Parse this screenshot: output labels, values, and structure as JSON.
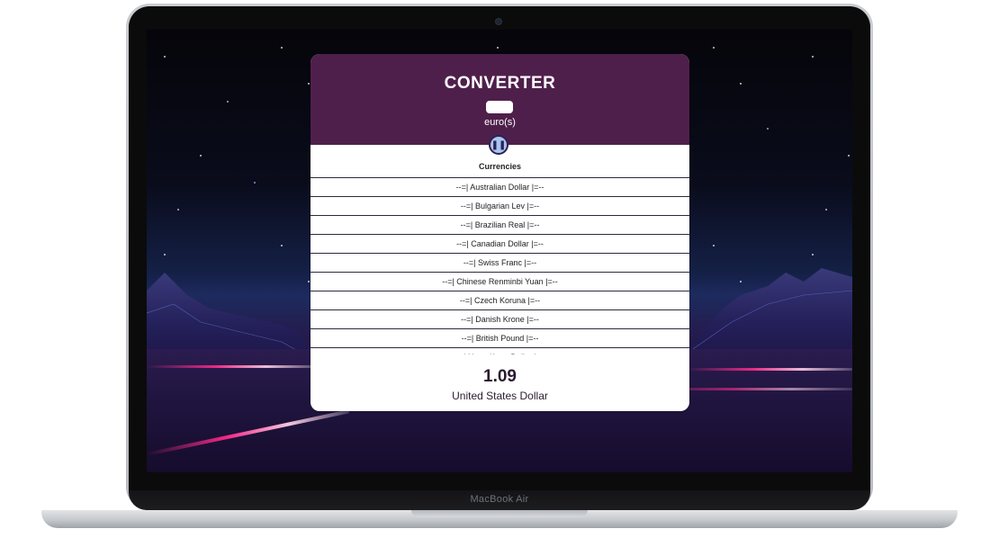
{
  "device": {
    "brand_label": "MacBook Air"
  },
  "converter": {
    "title": "CONVERTER",
    "amount_value": "",
    "unit_label": "euro(s)",
    "swap_icon": "pause-icon",
    "list_header": "Currencies",
    "currencies": [
      "--=| Australian Dollar |=--",
      "--=| Bulgarian Lev |=--",
      "--=| Brazilian Real |=--",
      "--=| Canadian Dollar |=--",
      "--=| Swiss Franc |=--",
      "--=| Chinese Renminbi Yuan |=--",
      "--=| Czech Koruna |=--",
      "--=| Danish Krone |=--",
      "--=| British Pound |=--",
      "--=| Hong Kong Dollar |=--"
    ],
    "result_value": "1.09",
    "result_currency": "United States Dollar"
  },
  "colors": {
    "header_bg": "#4f1f4b",
    "swap_button_bg": "#a8c4f2",
    "card_bg": "#ffffff"
  }
}
